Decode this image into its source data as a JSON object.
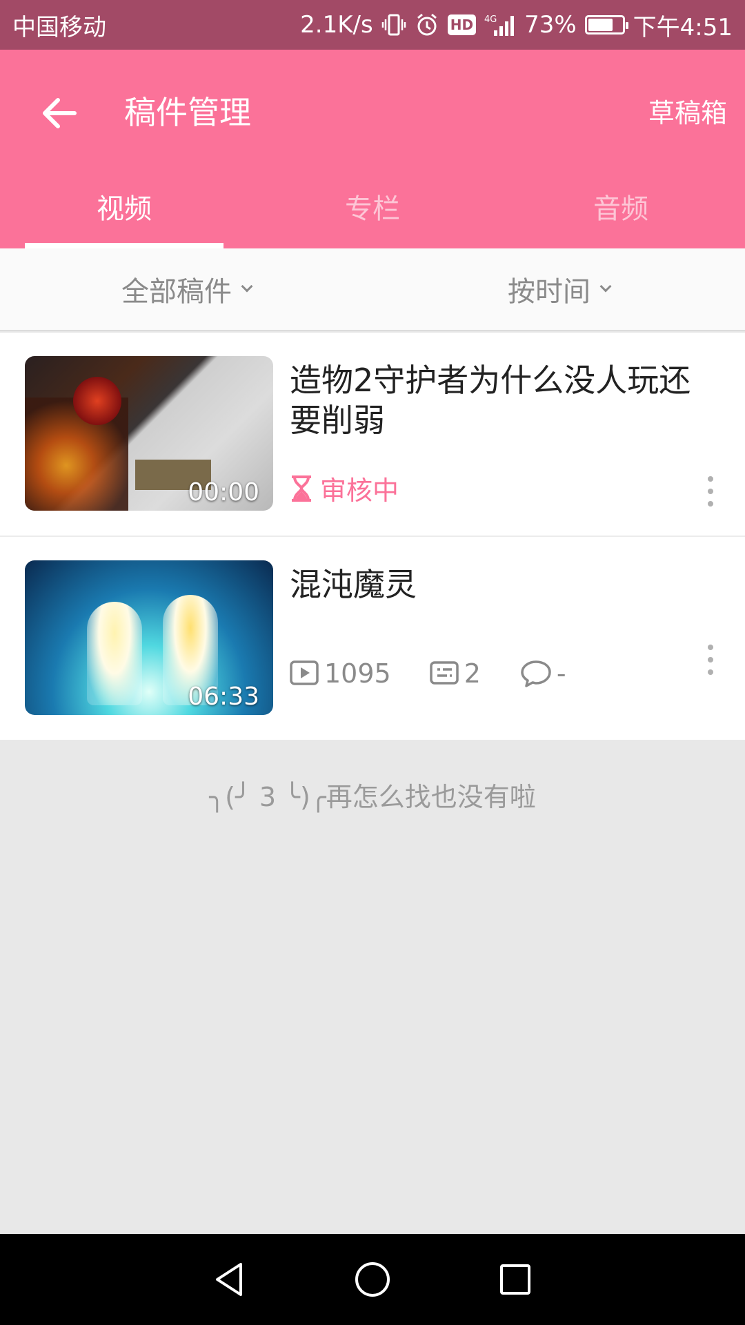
{
  "status_bar": {
    "carrier": "中国移动",
    "speed": "2.1K/s",
    "hd": "HD",
    "network": "4G",
    "battery": "73%",
    "battery_level": 0.73,
    "time": "下午4:51"
  },
  "app_bar": {
    "title": "稿件管理",
    "drafts_label": "草稿箱",
    "accent_color": "#fb7299",
    "tabs": [
      {
        "label": "视频",
        "active": true
      },
      {
        "label": "专栏",
        "active": false
      },
      {
        "label": "音频",
        "active": false
      }
    ]
  },
  "filters": {
    "type_label": "全部稿件",
    "sort_label": "按时间"
  },
  "videos": [
    {
      "title": "造物2守护者为什么没人玩还要削弱",
      "duration": "00:00",
      "status": "审核中"
    },
    {
      "title": "混沌魔灵",
      "duration": "06:33",
      "plays": "1095",
      "danmaku": "2",
      "comments": "-"
    }
  ],
  "end_message": "╮(╯ 3 ╰)╭再怎么找也没有啦"
}
